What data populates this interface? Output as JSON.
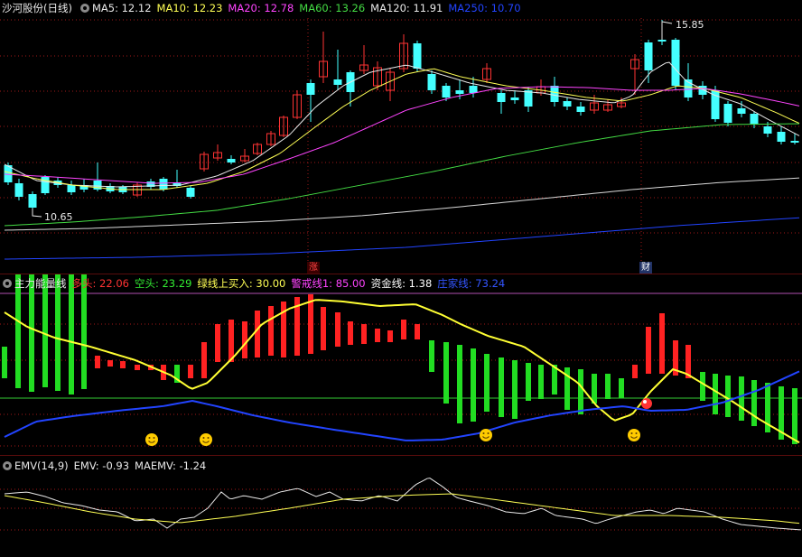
{
  "main": {
    "title": "沙河股份(日线)",
    "ma": [
      {
        "label": "MA5: 12.12",
        "color": "#e8e8e8"
      },
      {
        "label": "MA10: 12.23",
        "color": "#ffff55"
      },
      {
        "label": "MA20: 12.78",
        "color": "#ff44ff"
      },
      {
        "label": "MA60: 13.26",
        "color": "#44dd44"
      },
      {
        "label": "MA120: 11.91",
        "color": "#e8e8e8"
      },
      {
        "label": "MA250: 10.70",
        "color": "#2244ff"
      }
    ],
    "high_label": "15.85",
    "low_label": "10.65",
    "event_up": "涨",
    "event_fin": "财"
  },
  "indicator": {
    "title": "主力能量线",
    "items": [
      {
        "label": "多头: 22.06",
        "color": "#ff3333"
      },
      {
        "label": "空头: 23.29",
        "color": "#33ee33"
      },
      {
        "label": "绿线上买入: 30.00",
        "color": "#ffff55"
      },
      {
        "label": "警戒线1: 85.00",
        "color": "#ff44ff"
      },
      {
        "label": "资金线: 1.38",
        "color": "#ffffff"
      },
      {
        "label": "庄家线: 73.24",
        "color": "#3355ff"
      }
    ]
  },
  "emv": {
    "title": "EMV(14,9)",
    "items": [
      {
        "label": "EMV: -0.93",
        "color": "#e8e8e8"
      },
      {
        "label": "MAEMV: -1.24",
        "color": "#e8e8e8"
      }
    ]
  },
  "colors": {
    "up": "#ff3333",
    "down": "#44ffff",
    "grid": "#a01818"
  }
}
